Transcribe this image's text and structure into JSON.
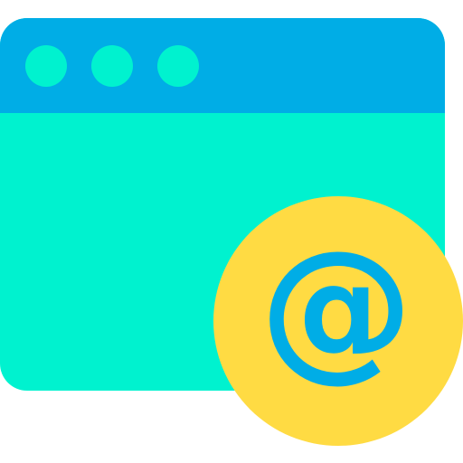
{
  "icon": {
    "name": "web-email-icon",
    "window": {
      "titlebar_color": "#00ADE6",
      "body_color": "#00F2CF",
      "dot_color": "#00F2CF",
      "dot_count": 3
    },
    "badge": {
      "circle_color": "#FFDB43",
      "symbol": "@",
      "symbol_color": "#00ADE6"
    }
  }
}
